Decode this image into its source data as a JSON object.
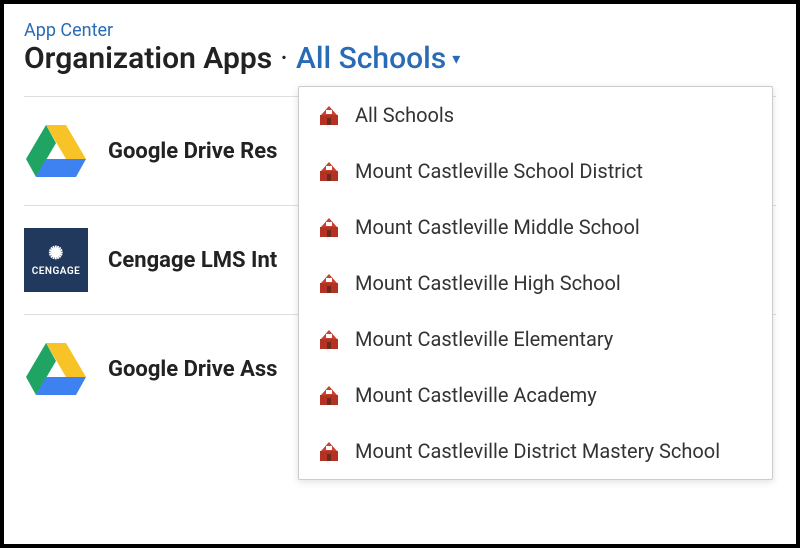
{
  "breadcrumb": "App Center",
  "page_title": "Organization Apps",
  "filter": {
    "selected_label": "All Schools"
  },
  "apps": [
    {
      "name": "Google Drive Res",
      "icon": "google-drive"
    },
    {
      "name": "Cengage LMS Int",
      "icon": "cengage"
    },
    {
      "name": "Google Drive Ass",
      "icon": "google-drive"
    }
  ],
  "dropdown": {
    "items": [
      {
        "label": "All Schools"
      },
      {
        "label": "Mount Castleville School District"
      },
      {
        "label": "Mount Castleville Middle School"
      },
      {
        "label": "Mount Castleville High School"
      },
      {
        "label": "Mount Castleville Elementary"
      },
      {
        "label": "Mount Castleville Academy"
      },
      {
        "label": "Mount Castleville District Mastery School"
      }
    ]
  },
  "cengage_text": "CENGAGE"
}
